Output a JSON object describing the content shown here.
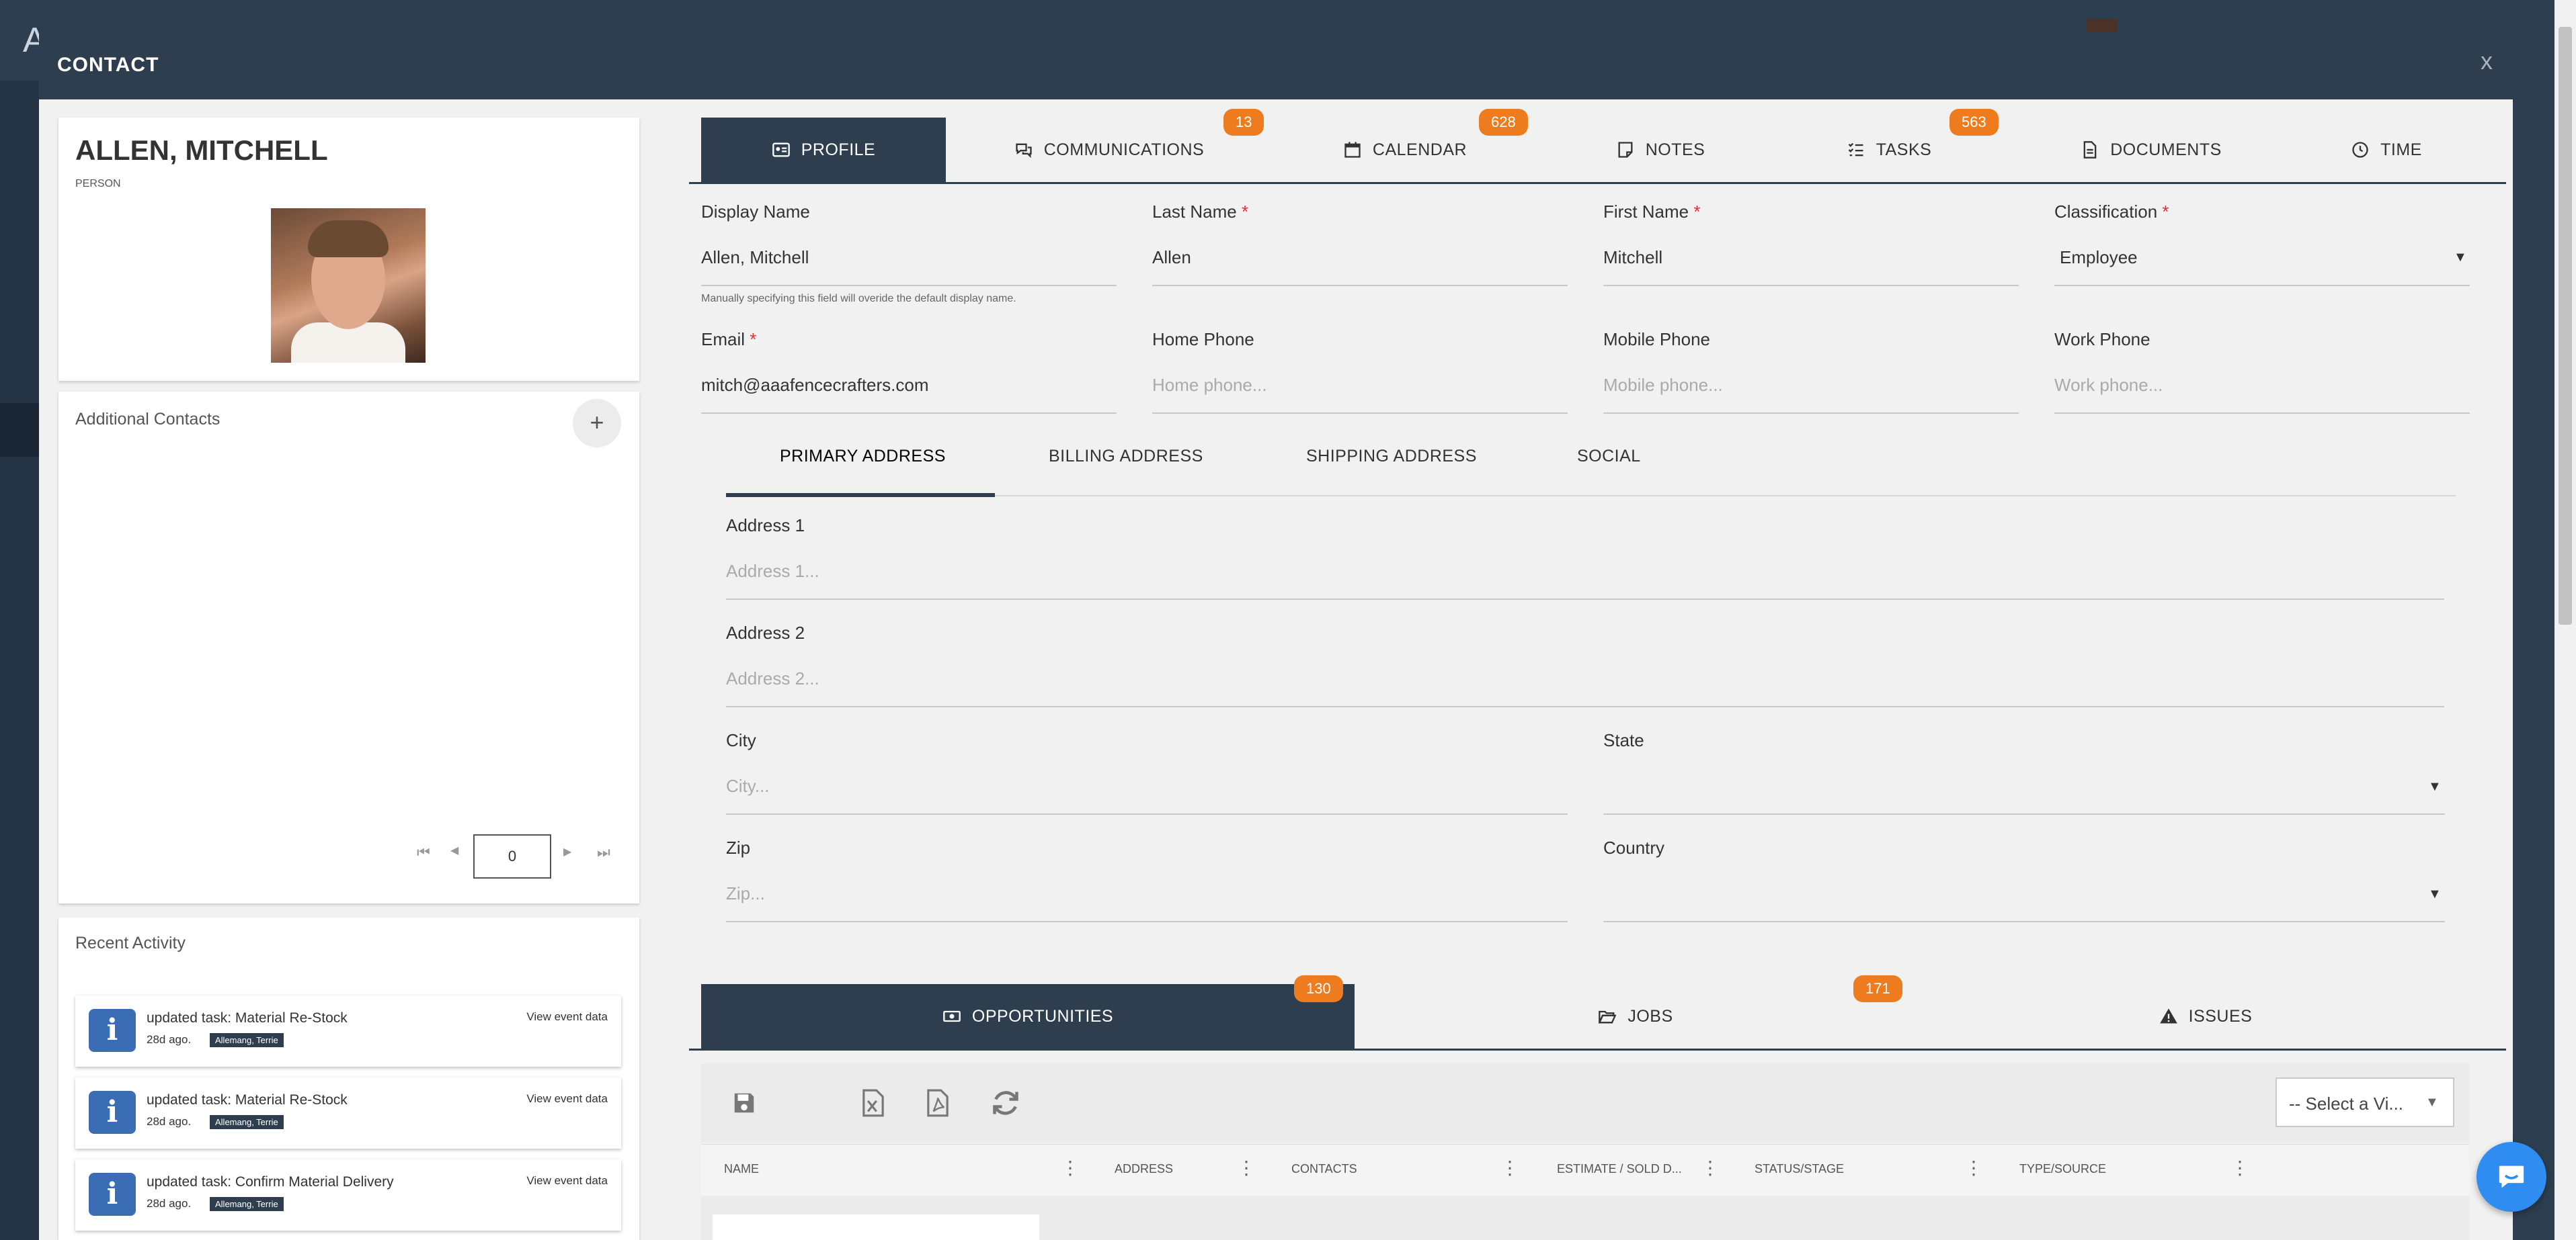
{
  "app": {
    "logo_letter": "A"
  },
  "modal": {
    "title": "CONTACT",
    "close_label": "x"
  },
  "contact": {
    "name": "ALLEN, MITCHELL",
    "type": "PERSON"
  },
  "additional_contacts": {
    "title": "Additional Contacts",
    "add_label": "+",
    "pager": {
      "page": "0",
      "first": "⏮",
      "prev": "◀",
      "next": "▶",
      "last": "⏭"
    }
  },
  "recent_activity": {
    "title": "Recent Activity",
    "items": [
      {
        "text": "updated task: Material Re-Stock",
        "ago": "28d ago.",
        "tag": "Allemang, Terrie",
        "view": "View event data"
      },
      {
        "text": "updated task: Material Re-Stock",
        "ago": "28d ago.",
        "tag": "Allemang, Terrie",
        "view": "View event data"
      },
      {
        "text": "updated task: Confirm Material Delivery",
        "ago": "28d ago.",
        "tag": "Allemang, Terrie",
        "view": "View event data"
      }
    ]
  },
  "tabs": [
    {
      "label": "PROFILE",
      "icon": "id-card-icon",
      "active": true
    },
    {
      "label": "COMMUNICATIONS",
      "icon": "chat-bubbles-icon",
      "badge": "13"
    },
    {
      "label": "CALENDAR",
      "icon": "calendar-icon",
      "badge": "628"
    },
    {
      "label": "NOTES",
      "icon": "note-icon"
    },
    {
      "label": "TASKS",
      "icon": "task-list-icon",
      "badge": "563"
    },
    {
      "label": "DOCUMENTS",
      "icon": "document-icon"
    },
    {
      "label": "TIME",
      "icon": "clock-icon"
    }
  ],
  "form": {
    "display_name": {
      "label": "Display Name",
      "value": "Allen, Mitchell",
      "hint": "Manually specifying this field will overide the default display name."
    },
    "last_name": {
      "label": "Last Name",
      "value": "Allen",
      "required": "*"
    },
    "first_name": {
      "label": "First Name",
      "value": "Mitchell",
      "required": "*"
    },
    "classification": {
      "label": "Classification",
      "value": "Employee",
      "required": "*"
    },
    "email": {
      "label": "Email",
      "value": "mitch@aaafencecrafters.com",
      "required": "*"
    },
    "home_phone": {
      "label": "Home Phone",
      "placeholder": "Home phone..."
    },
    "mobile_phone": {
      "label": "Mobile Phone",
      "placeholder": "Mobile phone..."
    },
    "work_phone": {
      "label": "Work Phone",
      "placeholder": "Work phone..."
    }
  },
  "address_tabs": [
    "PRIMARY ADDRESS",
    "BILLING ADDRESS",
    "SHIPPING ADDRESS",
    "SOCIAL"
  ],
  "address": {
    "address1": {
      "label": "Address 1",
      "placeholder": "Address 1..."
    },
    "address2": {
      "label": "Address 2",
      "placeholder": "Address 2..."
    },
    "city": {
      "label": "City",
      "placeholder": "City..."
    },
    "state": {
      "label": "State",
      "value": ""
    },
    "zip": {
      "label": "Zip",
      "placeholder": "Zip..."
    },
    "country": {
      "label": "Country",
      "value": ""
    }
  },
  "bottom_tabs": [
    {
      "label": "OPPORTUNITIES",
      "icon": "money-icon",
      "badge": "130",
      "active": true
    },
    {
      "label": "JOBS",
      "icon": "folder-open-icon",
      "badge": "171"
    },
    {
      "label": "ISSUES",
      "icon": "warning-icon"
    }
  ],
  "grid": {
    "view_select": "-- Select a Vi...",
    "columns": [
      "NAME",
      "ADDRESS",
      "CONTACTS",
      "ESTIMATE / SOLD D...",
      "STATUS/STAGE",
      "TYPE/SOURCE"
    ]
  },
  "colors": {
    "navy": "#2e3e4f",
    "badge_orange": "#ee7c1f",
    "chat_blue": "#2f8cf0"
  }
}
